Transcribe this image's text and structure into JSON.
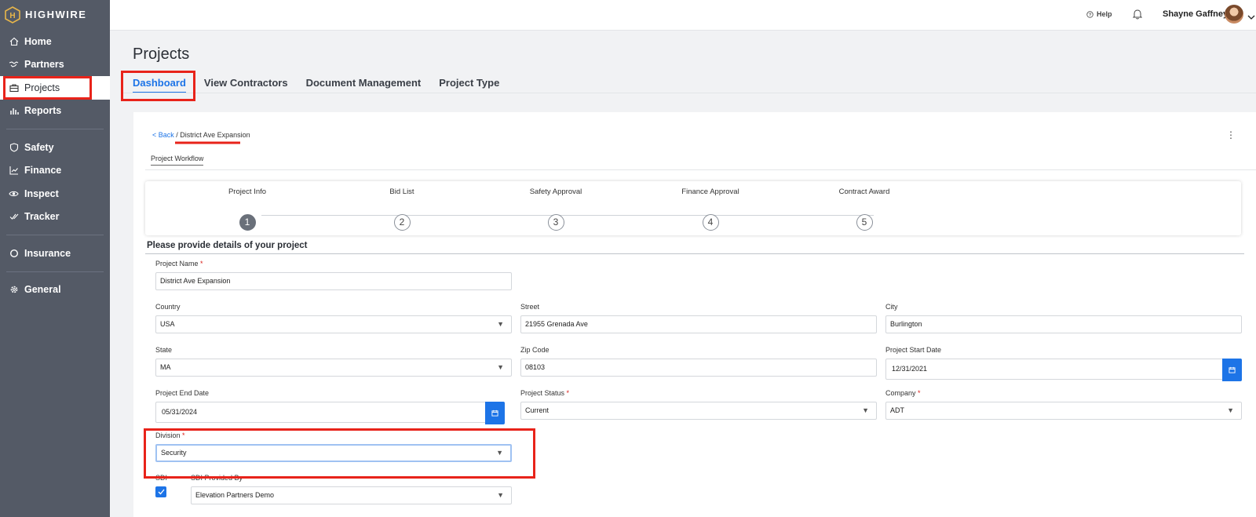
{
  "app": {
    "brand": "HIGHWIRE",
    "brand_letter": "H"
  },
  "sidebar": {
    "items": [
      {
        "label": "Home",
        "icon": "home-icon"
      },
      {
        "label": "Partners",
        "icon": "handshake-icon"
      },
      {
        "label": "Projects",
        "icon": "briefcase-icon",
        "active": true
      },
      {
        "label": "Reports",
        "icon": "bar-chart-icon"
      },
      {
        "label": "Safety",
        "icon": "shield-icon"
      },
      {
        "label": "Finance",
        "icon": "line-chart-icon"
      },
      {
        "label": "Inspect",
        "icon": "eye-icon"
      },
      {
        "label": "Tracker",
        "icon": "double-check-icon"
      },
      {
        "label": "Insurance",
        "icon": "ring-icon"
      },
      {
        "label": "General",
        "icon": "gear-icon"
      }
    ]
  },
  "topbar": {
    "help": "Help",
    "user_name": "Shayne Gaffney"
  },
  "page": {
    "title": "Projects",
    "tabs": [
      "Dashboard",
      "View Contractors",
      "Document Management",
      "Project Type"
    ],
    "active_tab": "Dashboard"
  },
  "breadcrumb": {
    "back": "< Back",
    "separator": " / ",
    "current": "District Ave Expansion"
  },
  "subtab": "Project Workflow",
  "workflow": {
    "steps": [
      {
        "label": "Project Info",
        "num": "1"
      },
      {
        "label": "Bid List",
        "num": "2"
      },
      {
        "label": "Safety Approval",
        "num": "3"
      },
      {
        "label": "Finance Approval",
        "num": "4"
      },
      {
        "label": "Contract Award",
        "num": "5"
      }
    ],
    "current_step": 1
  },
  "form": {
    "section_title": "Please provide details of your project",
    "project_name": {
      "label": "Project Name",
      "value": "District Ave Expansion"
    },
    "country": {
      "label": "Country",
      "value": "USA"
    },
    "street": {
      "label": "Street",
      "value": "21955 Grenada Ave"
    },
    "city": {
      "label": "City",
      "value": "Burlington"
    },
    "state": {
      "label": "State",
      "value": "MA"
    },
    "zip": {
      "label": "Zip Code",
      "value": "08103"
    },
    "start_date": {
      "label": "Project Start Date",
      "value": "12/31/2021"
    },
    "end_date": {
      "label": "Project End Date",
      "value": "05/31/2024"
    },
    "status": {
      "label": "Project Status",
      "value": "Current"
    },
    "company": {
      "label": "Company",
      "value": "ADT"
    },
    "division": {
      "label": "Division",
      "value": "Security"
    },
    "sdi": {
      "label": "SDI",
      "checked": true
    },
    "sdi_provider": {
      "label": "SDI Provided By",
      "value": "Elevation Partners Demo"
    },
    "required_mark": "*",
    "dropdown_arrow": "▼"
  },
  "colors": {
    "accent": "#1d74e7",
    "sidebar": "#545a66",
    "highlight": "#e8231a",
    "brand_gold": "#e8b64a"
  }
}
